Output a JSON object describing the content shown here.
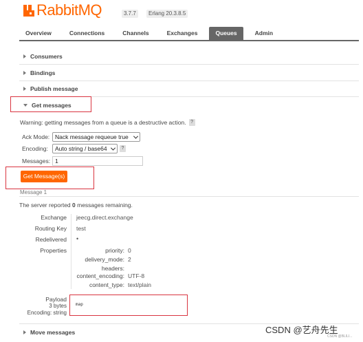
{
  "header": {
    "logo_rabbit": "Rabbit",
    "logo_mq": "MQ",
    "version": "3.7.7",
    "erlang": "Erlang 20.3.8.5"
  },
  "tabs": [
    {
      "label": "Overview"
    },
    {
      "label": "Connections"
    },
    {
      "label": "Channels"
    },
    {
      "label": "Exchanges"
    },
    {
      "label": "Queues",
      "active": true
    },
    {
      "label": "Admin"
    }
  ],
  "sections": {
    "consumers": "Consumers",
    "bindings": "Bindings",
    "publish": "Publish message",
    "get": "Get messages",
    "move": "Move messages"
  },
  "get_messages": {
    "warning": "Warning: getting messages from a queue is a destructive action.",
    "help": "?",
    "ack_label": "Ack Mode:",
    "ack_value": "Nack message requeue true",
    "encoding_label": "Encoding:",
    "encoding_value": "Auto string / base64",
    "messages_label": "Messages:",
    "messages_value": "1",
    "button": "Get Message(s)"
  },
  "result": {
    "title": "Message 1",
    "remaining_prefix": "The server reported ",
    "remaining_count": "0",
    "remaining_suffix": " messages remaining.",
    "exchange_key": "Exchange",
    "exchange_val": "jeecg.direct.exchange",
    "routing_key": "Routing Key",
    "routing_val": "test",
    "redelivered_key": "Redelivered",
    "redelivered_val": "•",
    "properties_key": "Properties",
    "properties": [
      {
        "k": "priority:",
        "v": "0"
      },
      {
        "k": "delivery_mode:",
        "v": "2"
      },
      {
        "k": "headers:",
        "v": ""
      },
      {
        "k": "content_encoding:",
        "v": "UTF-8"
      },
      {
        "k": "content_type:",
        "v": "text/plain"
      }
    ],
    "payload_key": "Payload",
    "payload_bytes": "3 bytes",
    "payload_encoding": "Encoding: string",
    "payload_value": "map"
  },
  "watermark": "CSDN @艺舟先生",
  "watermark_small": "CSDN @BLILI..."
}
